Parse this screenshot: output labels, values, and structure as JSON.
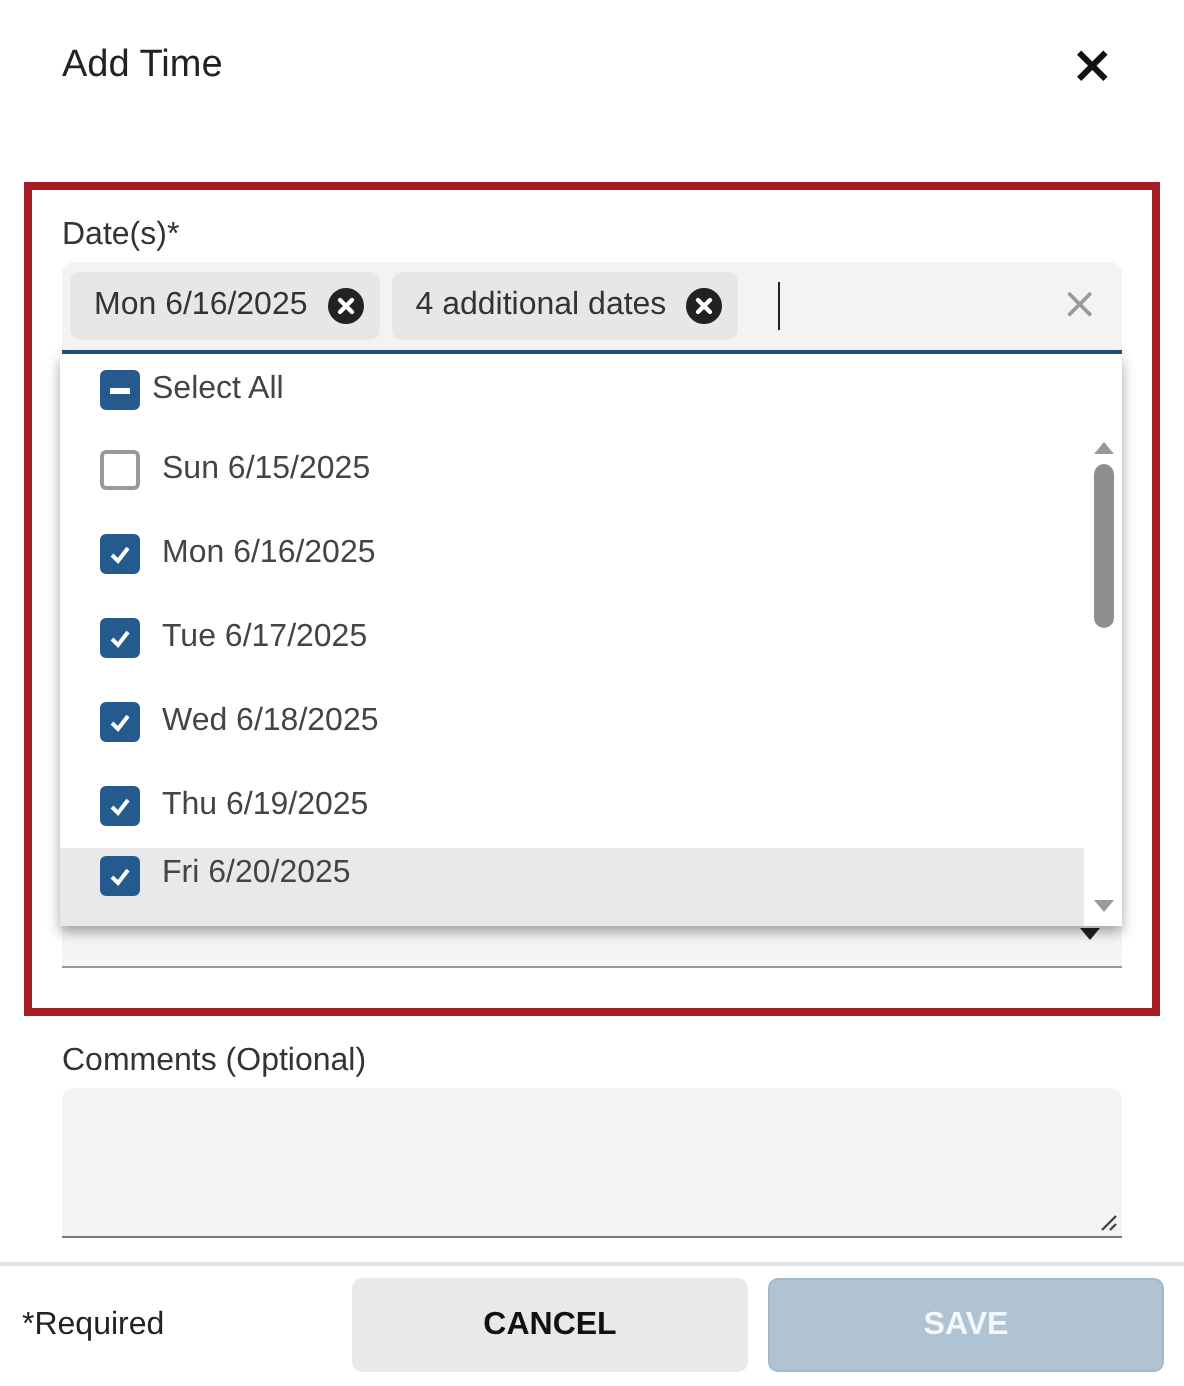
{
  "dialog": {
    "title": "Add Time",
    "close": "×"
  },
  "dates_field": {
    "label": "Date(s)*",
    "chips": [
      {
        "label": "Mon 6/16/2025"
      },
      {
        "label": "4 additional dates"
      }
    ],
    "clear": "×",
    "focused": true,
    "select_all": {
      "label": "Select All",
      "indeterminate": true
    },
    "options": [
      {
        "label": "Sun 6/15/2025",
        "checked": false,
        "highlighted": false
      },
      {
        "label": "Mon 6/16/2025",
        "checked": true,
        "highlighted": false
      },
      {
        "label": "Tue 6/17/2025",
        "checked": true,
        "highlighted": false
      },
      {
        "label": "Wed 6/18/2025",
        "checked": true,
        "highlighted": false
      },
      {
        "label": "Thu 6/19/2025",
        "checked": true,
        "highlighted": false
      },
      {
        "label": "Fri 6/20/2025",
        "checked": true,
        "highlighted": true
      }
    ]
  },
  "comments": {
    "label": "Comments (Optional)"
  },
  "footer": {
    "note": "*Required",
    "buttons": [
      {
        "label": "CANCEL",
        "disabled": false
      },
      {
        "label": "SAVE",
        "disabled": true
      }
    ]
  }
}
